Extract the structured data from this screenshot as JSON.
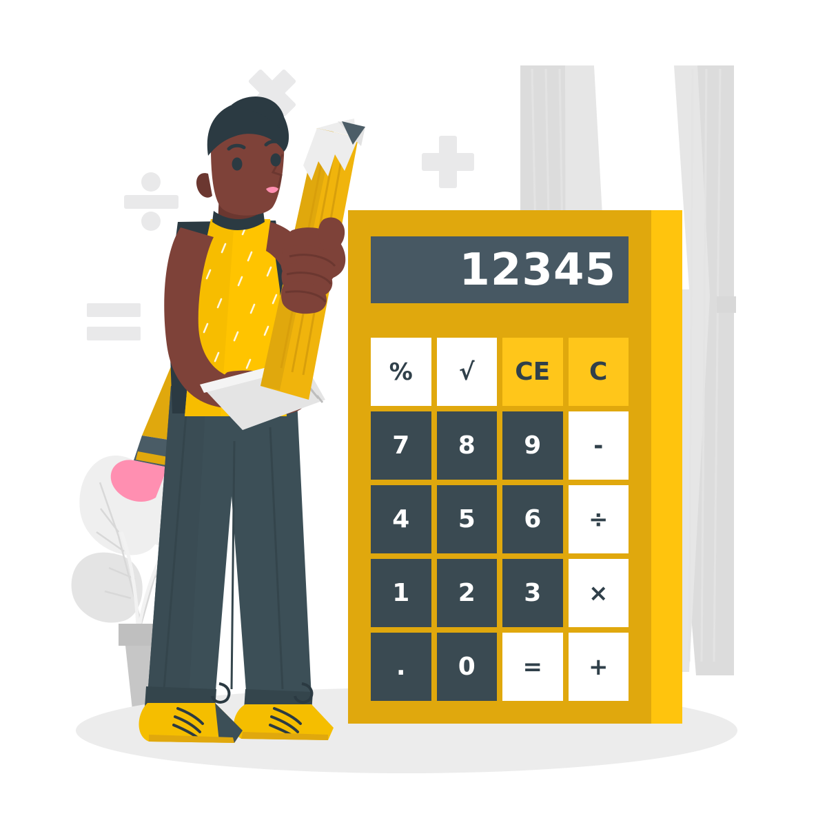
{
  "scene": {
    "title": "Calculator concept illustration",
    "background_color": "#ffffff",
    "ground_shadow_color": "#ECECEC"
  },
  "palette": {
    "calculator_body": "#E0A80D",
    "calculator_side_highlight": "#FFC40D",
    "display_background": "#475863",
    "display_text": "#FFFFFF",
    "key_dark": "#3A4A52",
    "key_white": "#FFFFFF",
    "key_amber": "#FFC61A",
    "key_dark_text": "#30404A",
    "shirt_yellow": "#FFC400",
    "trousers_slate": "#3C4F57",
    "skin": "#7E4239",
    "skin_shadow": "#6B3730",
    "hair": "#2B3A42",
    "shoe_yellow": "#F5BE00",
    "eraser_pink": "#FF8FB1",
    "symbol_gray": "#E9E9EA",
    "plant_gray": "#E2E2E2",
    "pot_gray": "#BFBFBF",
    "pencil_yellow": "#F0B40C",
    "pencil_wood": "#EDEDED",
    "pencil_tip": "#4C5D67"
  },
  "calculator": {
    "display": {
      "value": "12345"
    },
    "keys": [
      {
        "label": "%",
        "style": "white",
        "name": "percent"
      },
      {
        "label": "√",
        "style": "white",
        "name": "square-root"
      },
      {
        "label": "CE",
        "style": "amber",
        "name": "clear-entry"
      },
      {
        "label": "C",
        "style": "amber",
        "name": "clear"
      },
      {
        "label": "7",
        "style": "dark",
        "name": "digit-7"
      },
      {
        "label": "8",
        "style": "dark",
        "name": "digit-8"
      },
      {
        "label": "9",
        "style": "dark",
        "name": "digit-9"
      },
      {
        "label": "-",
        "style": "white",
        "name": "minus"
      },
      {
        "label": "4",
        "style": "dark",
        "name": "digit-4"
      },
      {
        "label": "5",
        "style": "dark",
        "name": "digit-5"
      },
      {
        "label": "6",
        "style": "dark",
        "name": "digit-6"
      },
      {
        "label": "÷",
        "style": "white",
        "name": "divide"
      },
      {
        "label": "1",
        "style": "dark",
        "name": "digit-1"
      },
      {
        "label": "2",
        "style": "dark",
        "name": "digit-2"
      },
      {
        "label": "3",
        "style": "dark",
        "name": "digit-3"
      },
      {
        "label": "×",
        "style": "white",
        "name": "multiply"
      },
      {
        "label": ".",
        "style": "dark",
        "name": "decimal-point"
      },
      {
        "label": "0",
        "style": "dark",
        "name": "digit-0"
      },
      {
        "label": "=",
        "style": "white",
        "name": "equals"
      },
      {
        "label": "+",
        "style": "white",
        "name": "plus"
      }
    ]
  },
  "background_symbols": [
    {
      "name": "multiply-symbol",
      "glyph": "×"
    },
    {
      "name": "plus-symbol",
      "glyph": "+"
    },
    {
      "name": "divide-symbol",
      "glyph": "÷"
    },
    {
      "name": "equals-symbol",
      "glyph": "="
    }
  ],
  "character": {
    "name": "person-holding-pencil",
    "items": [
      "giant-pencil",
      "spiral-notepad",
      "second-pencil"
    ]
  },
  "decor": {
    "window": "window-with-curtains",
    "plant": "potted-plant"
  }
}
